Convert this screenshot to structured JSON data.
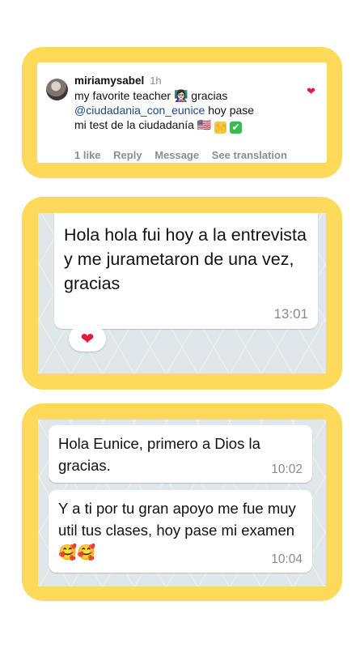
{
  "comment": {
    "username": "miriamysabel",
    "time": "1h",
    "text_before": "my favorite teacher",
    "text_after_emoji": "gracias",
    "mention": "@ciudadania_con_eunice",
    "text_after_mention": "hoy pase",
    "line3": "mi test de la ciudadanía",
    "emoji_teacher": "👩🏻‍🏫",
    "emoji_flag": "🇺🇸",
    "emoji_hands": "🙌",
    "emoji_check": "✔",
    "actions": {
      "likes": "1 like",
      "reply": "Reply",
      "message": "Message",
      "translate": "See translation"
    },
    "heart_color": "#e5193b"
  },
  "chat1": {
    "message": "Hola hola fui hoy a la entrevista y me jurametaron de una vez, gracias",
    "time": "13:01",
    "reaction": "❤"
  },
  "chat2": {
    "messages": [
      {
        "text": "Hola Eunice, primero a Dios la gracias.",
        "time": "10:02"
      },
      {
        "text": "Y a ti por tu gran apoyo me fue muy util tus clases, hoy pase mi examen 🥰🥰",
        "time": "10:04"
      }
    ]
  },
  "colors": {
    "frame": "#ffd95a",
    "chat_bg": "#dfe7ea",
    "mention": "#1c4a8c"
  }
}
